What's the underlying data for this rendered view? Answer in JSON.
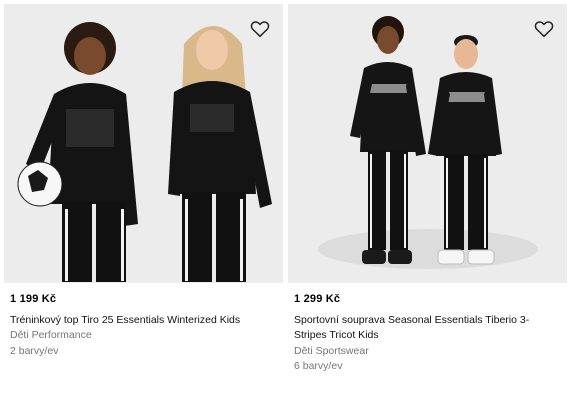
{
  "products": [
    {
      "price": "1 199 Kč",
      "name": "Tréninkový top Tiro 25 Essentials Winterized Kids",
      "category": "Děti Performance",
      "colors": "2 barvy/ev"
    },
    {
      "price": "1 299 Kč",
      "name": "Sportovní souprava Seasonal Essentials Tiberio 3-Stripes Tricot Kids",
      "category": "Děti Sportswear",
      "colors": "6 barvy/ev"
    }
  ],
  "icons": {
    "wishlist": "heart-outline-icon"
  }
}
